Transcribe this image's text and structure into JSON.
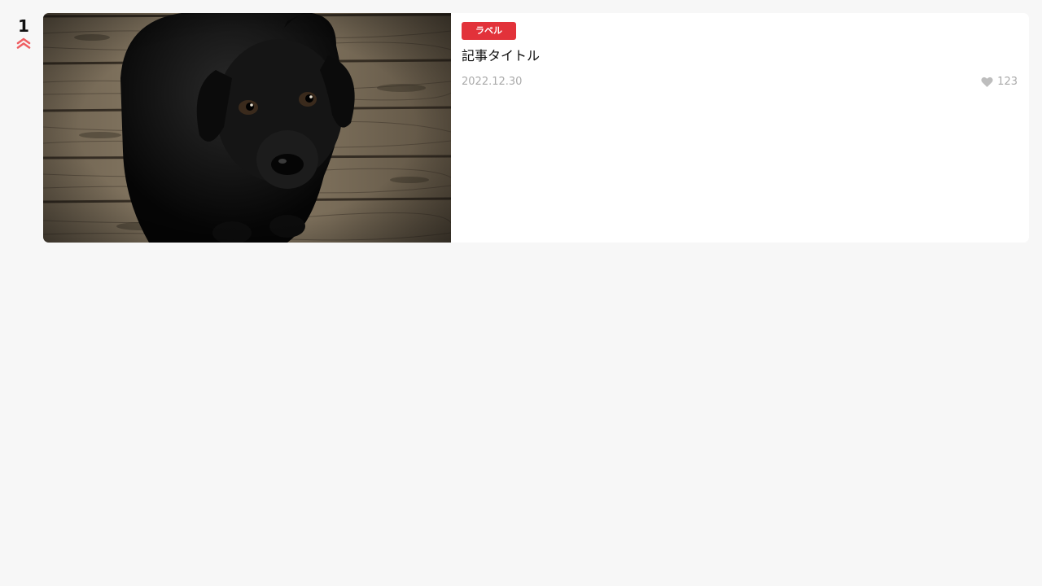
{
  "ranking": {
    "rank": "1",
    "trend_icon": "double-chevron-up-icon",
    "trend_color": "#e2323a"
  },
  "article": {
    "image_subject": "black puppy sitting on wooden floor",
    "label": "ラベル",
    "label_color": "#e2323a",
    "title": "記事タイトル",
    "date": "2022.12.30",
    "likes_icon": "heart-icon",
    "likes": "123"
  }
}
